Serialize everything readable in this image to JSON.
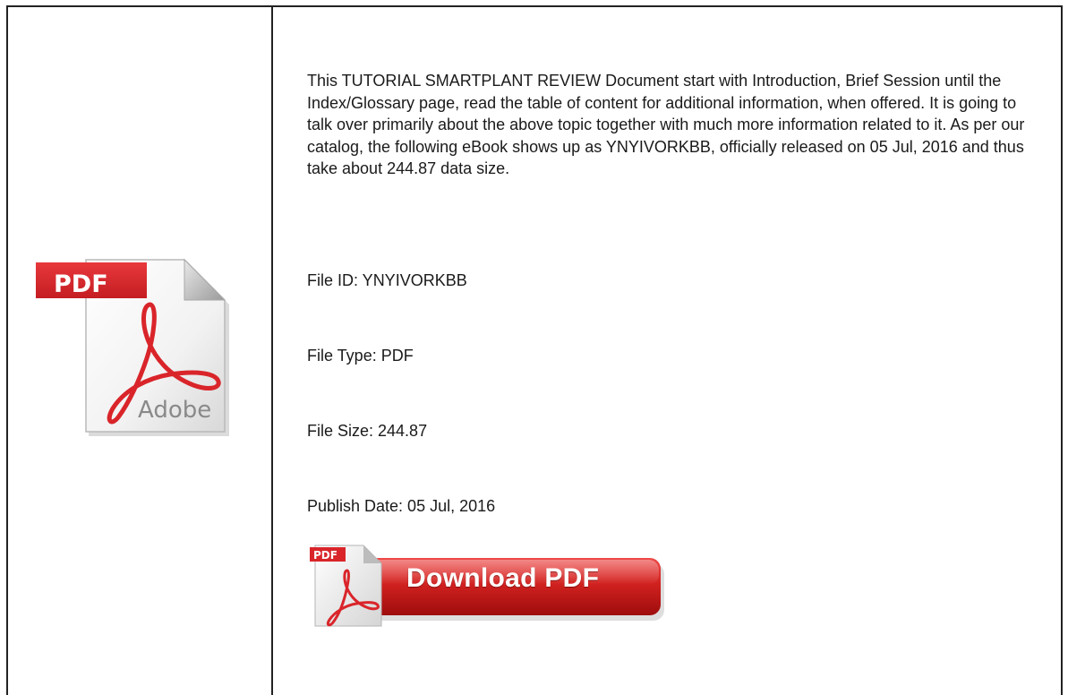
{
  "document": {
    "description": "This TUTORIAL SMARTPLANT REVIEW Document start with Introduction, Brief Session until the Index/Glossary page, read the table of content for additional information, when offered. It is going to talk over primarily about the above topic together with much more information related to it. As per our catalog, the following eBook shows up as YNYIVORKBB, officially released on 05 Jul, 2016 and thus take about 244.87 data size.",
    "file_id": "File ID: YNYIVORKBB",
    "file_type": "File Type: PDF",
    "file_size": "File Size: 244.87",
    "publish_date": "Publish Date: 05 Jul, 2016"
  },
  "pdf_icon": {
    "icon": "pdf-document-icon",
    "badge_text": "PDF",
    "brand_text": "Adobe",
    "badge_color": "#d9252a",
    "acrobat_color": "#d9252a"
  },
  "download_button": {
    "label": "Download PDF",
    "badge_text": "PDF",
    "icon": "pdf-download-icon",
    "color": "#c8191d"
  }
}
